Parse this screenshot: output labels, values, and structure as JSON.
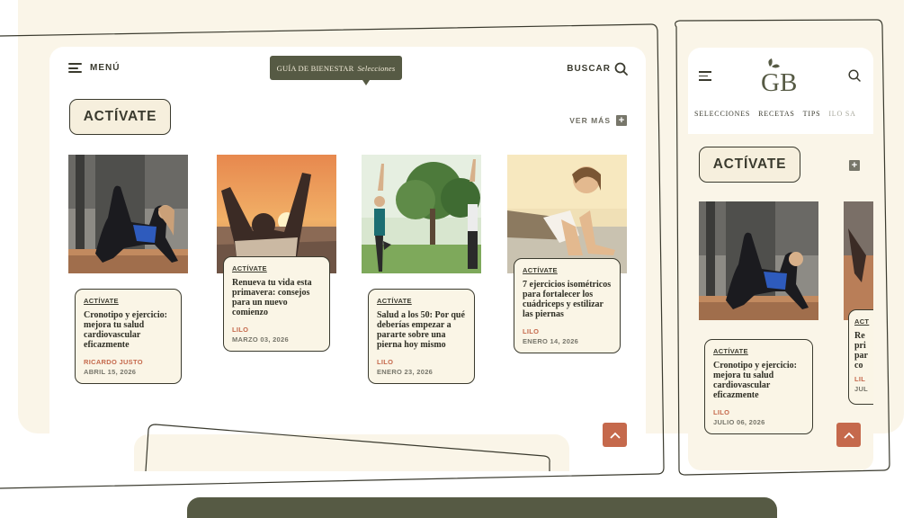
{
  "desktop": {
    "header": {
      "menu_label": "MENÚ",
      "logo_text": "GUÍA DE BIENESTAR",
      "logo_brand": "Selecciones",
      "search_label": "BUSCAR"
    },
    "section": {
      "title": "ACTÍVATE",
      "more_label": "VER MÁS",
      "more_icon": "+"
    },
    "cards": [
      {
        "tag": "ACTÍVATE",
        "title": "Cronotipo y ejercicio: mejora tu salud cardiovascular eficazmente",
        "author": "RICARDO JUSTO",
        "date": "ABRIL 15, 2026",
        "image": "yoga-kneeling-leg-raise-photo"
      },
      {
        "tag": "ACTÍVATE",
        "title": "Renueva tu vida esta primavera: consejos para un nuevo comienzo",
        "author": "LILO",
        "date": "MARZO 03, 2026",
        "image": "sunset-arms-raised-photo"
      },
      {
        "tag": "ACTÍVATE",
        "title": "Salud a los 50: Por qué deberías empezar a pararte sobre una pierna hoy mismo",
        "author": "LILO",
        "date": "ENERO 23, 2026",
        "image": "park-tree-pose-photo"
      },
      {
        "tag": "ACTÍVATE",
        "title": "7 ejercicios isométricos para fortalecer los cuádriceps y estilizar las piernas",
        "author": "LILO",
        "date": "ENERO 14, 2026",
        "image": "plank-woman-photo"
      }
    ]
  },
  "mobile": {
    "logo": "GB",
    "nav": [
      "SELECCIONES",
      "RECETAS",
      "TIPS",
      "ILO SA"
    ],
    "section_title": "ACTÍVATE",
    "more_icon": "+",
    "cards": [
      {
        "tag": "ACTÍVATE",
        "title": "Cronotipo y ejercicio: mejora tu salud cardiovascular eficazmente",
        "author": "LILO",
        "date": "JULIO 06, 2026"
      }
    ],
    "peek_card": {
      "tag": "ACT",
      "lines": [
        "Re",
        "pri",
        "par",
        "co"
      ],
      "author": "LIL",
      "date": "JUL"
    }
  },
  "colors": {
    "cream": "#faf5e8",
    "olive": "#565a44",
    "terracotta": "#c5694c",
    "text": "#3a3a2e"
  },
  "icons": [
    "hamburger-icon",
    "search-icon",
    "plus-icon",
    "chevron-up-icon",
    "leaf-icon"
  ]
}
